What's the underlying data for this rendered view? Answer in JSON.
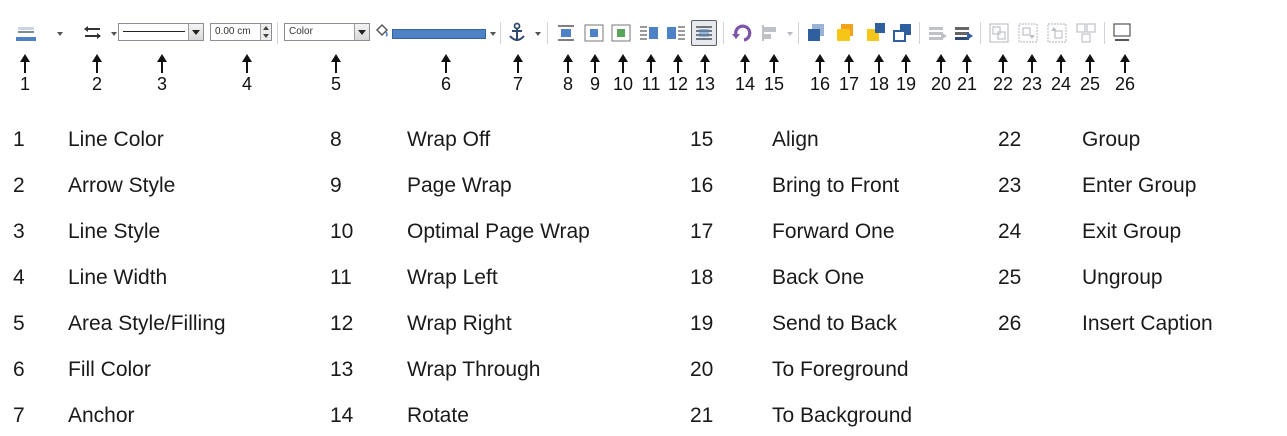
{
  "toolbar": {
    "line_width_value": "0.00 cm",
    "area_style_value": "Color",
    "buttons": [
      {
        "id": 1,
        "name": "Line Color",
        "icon": "line-color-icon"
      },
      {
        "id": 2,
        "name": "Arrow Style",
        "icon": "arrow-style-icon"
      },
      {
        "id": 3,
        "name": "Line Style",
        "icon": "line-style-icon"
      },
      {
        "id": 4,
        "name": "Line Width",
        "icon": "line-width-icon"
      },
      {
        "id": 5,
        "name": "Area Style/Filling",
        "icon": "area-style-icon"
      },
      {
        "id": 6,
        "name": "Fill Color",
        "icon": "fill-color-icon"
      },
      {
        "id": 7,
        "name": "Anchor",
        "icon": "anchor-icon"
      },
      {
        "id": 8,
        "name": "Wrap Off",
        "icon": "wrap-off-icon"
      },
      {
        "id": 9,
        "name": "Page Wrap",
        "icon": "page-wrap-icon"
      },
      {
        "id": 10,
        "name": "Optimal Page Wrap",
        "icon": "optimal-page-wrap-icon"
      },
      {
        "id": 11,
        "name": "Wrap Left",
        "icon": "wrap-left-icon"
      },
      {
        "id": 12,
        "name": "Wrap Right",
        "icon": "wrap-right-icon"
      },
      {
        "id": 13,
        "name": "Wrap Through",
        "icon": "wrap-through-icon",
        "active": true
      },
      {
        "id": 14,
        "name": "Rotate",
        "icon": "rotate-icon"
      },
      {
        "id": 15,
        "name": "Align",
        "icon": "align-icon",
        "disabled": true
      },
      {
        "id": 16,
        "name": "Bring to Front",
        "icon": "bring-to-front-icon"
      },
      {
        "id": 17,
        "name": "Forward One",
        "icon": "forward-one-icon"
      },
      {
        "id": 18,
        "name": "Back One",
        "icon": "back-one-icon"
      },
      {
        "id": 19,
        "name": "Send to Back",
        "icon": "send-to-back-icon"
      },
      {
        "id": 20,
        "name": "To Foreground",
        "icon": "to-foreground-icon",
        "disabled": true
      },
      {
        "id": 21,
        "name": "To Background",
        "icon": "to-background-icon"
      },
      {
        "id": 22,
        "name": "Group",
        "icon": "group-icon",
        "disabled": true
      },
      {
        "id": 23,
        "name": "Enter Group",
        "icon": "enter-group-icon",
        "disabled": true
      },
      {
        "id": 24,
        "name": "Exit Group",
        "icon": "exit-group-icon",
        "disabled": true
      },
      {
        "id": 25,
        "name": "Ungroup",
        "icon": "ungroup-icon",
        "disabled": true
      },
      {
        "id": 26,
        "name": "Insert Caption",
        "icon": "insert-caption-icon"
      }
    ]
  },
  "callouts": [
    "1",
    "2",
    "3",
    "4",
    "5",
    "6",
    "7",
    "8",
    "9",
    "10",
    "11",
    "12",
    "13",
    "14",
    "15",
    "16",
    "17",
    "18",
    "19",
    "20",
    "21",
    "22",
    "23",
    "24",
    "25",
    "26"
  ],
  "legend": [
    {
      "num": "1",
      "label": "Line Color"
    },
    {
      "num": "2",
      "label": "Arrow Style"
    },
    {
      "num": "3",
      "label": "Line Style"
    },
    {
      "num": "4",
      "label": "Line Width"
    },
    {
      "num": "5",
      "label": "Area Style/Filling"
    },
    {
      "num": "6",
      "label": "Fill Color"
    },
    {
      "num": "7",
      "label": "Anchor"
    },
    {
      "num": "8",
      "label": "Wrap Off"
    },
    {
      "num": "9",
      "label": "Page Wrap"
    },
    {
      "num": "10",
      "label": "Optimal Page Wrap"
    },
    {
      "num": "11",
      "label": "Wrap Left"
    },
    {
      "num": "12",
      "label": "Wrap Right"
    },
    {
      "num": "13",
      "label": "Wrap Through"
    },
    {
      "num": "14",
      "label": "Rotate"
    },
    {
      "num": "15",
      "label": "Align"
    },
    {
      "num": "16",
      "label": "Bring to Front"
    },
    {
      "num": "17",
      "label": "Forward One"
    },
    {
      "num": "18",
      "label": "Back One"
    },
    {
      "num": "19",
      "label": "Send to Back"
    },
    {
      "num": "20",
      "label": "To Foreground"
    },
    {
      "num": "21",
      "label": "To Background"
    },
    {
      "num": "22",
      "label": "Group"
    },
    {
      "num": "23",
      "label": "Enter Group"
    },
    {
      "num": "24",
      "label": "Exit Group"
    },
    {
      "num": "25",
      "label": "Ungroup"
    },
    {
      "num": "26",
      "label": "Insert Caption"
    }
  ],
  "colors": {
    "accent_blue": "#4f82c4",
    "icon_dark": "#2f4a6d",
    "orange": "#f2a21b",
    "gold": "#f5c518",
    "purple": "#7a55a8",
    "disabled": "#b8bcc2"
  }
}
